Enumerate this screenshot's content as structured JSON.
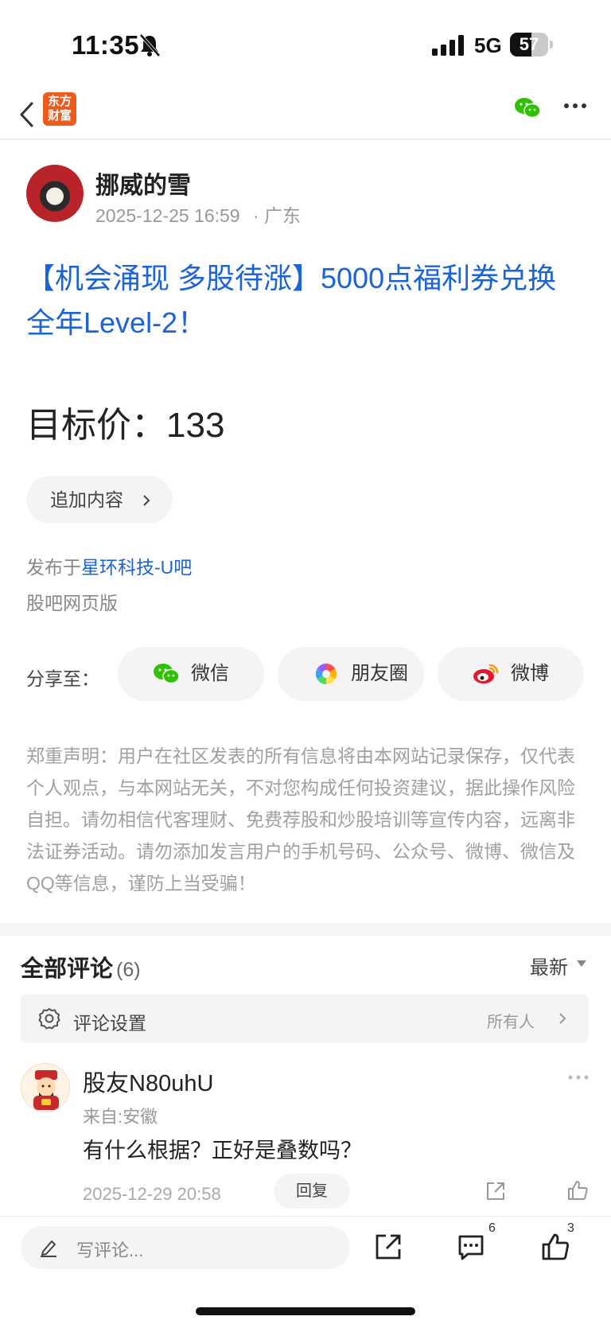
{
  "status_bar": {
    "time": "11:35",
    "network": "5G",
    "battery": "57",
    "battery_level": 0.57
  },
  "nav": {
    "logo_text_line1": "东方",
    "logo_text_line2": "财富",
    "icons": [
      "back-icon",
      "wechat-icon",
      "more-icon"
    ]
  },
  "post": {
    "author": "挪威的雪",
    "datetime": "2025-12-25 16:59",
    "location": "· 广东",
    "title": "【机会涌现 多股待涨】5000点福利券兑换全年Level-2！",
    "body": "目标价：133",
    "append_button": "追加内容",
    "published_prefix": "发布于",
    "published_board": "星环科技-U吧",
    "source": "股吧网页版"
  },
  "share": {
    "label": "分享至：",
    "targets": [
      "微信",
      "朋友圈",
      "微博"
    ]
  },
  "disclaimer": "郑重声明：用户在社区发表的所有信息将由本网站记录保存，仅代表个人观点，与本网站无关，不对您构成任何投资建议，据此操作风险自担。请勿相信代客理财、免费荐股和炒股培训等宣传内容，远离非法证券活动。请勿添加发言用户的手机号码、公众号、微博、微信及QQ等信息，谨防上当受骗！",
  "comments": {
    "title": "全部评论",
    "count": "(6)",
    "sort": "最新",
    "settings_label": "评论设置",
    "settings_value": "所有人",
    "items": [
      {
        "user": "股友N80uhU",
        "location": "来自:安徽",
        "text": "有什么根据？正好是叠数吗？",
        "time": "2025-12-29 20:58",
        "reply_label": "回复"
      }
    ]
  },
  "bottom_bar": {
    "input_placeholder": "写评论...",
    "comment_count": "6",
    "like_count": "3"
  },
  "colors": {
    "link_blue": "#1a63d9",
    "brand_orange": "#f05a1a",
    "wechat_green": "#2dc100",
    "weibo_red": "#e6162d"
  }
}
